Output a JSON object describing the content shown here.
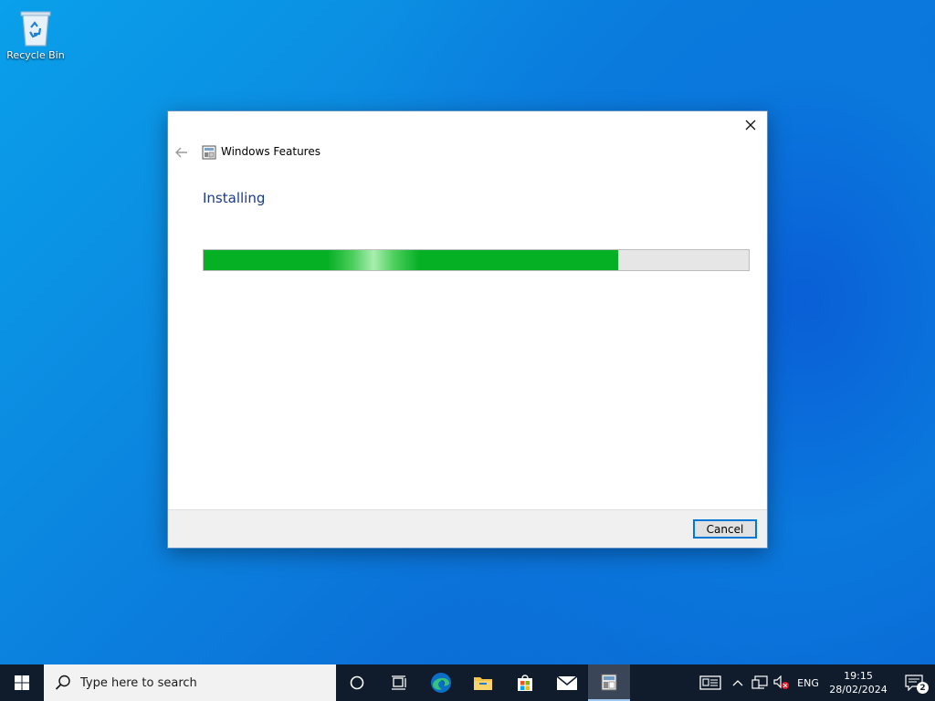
{
  "desktop": {
    "recycle_bin_label": "Recycle Bin"
  },
  "dialog": {
    "title": "Windows Features",
    "heading": "Installing",
    "progress_fraction": 0.76,
    "cancel_label": "Cancel",
    "colors": {
      "accent": "#0078d7",
      "progress": "#06b025",
      "heading": "#1a3b8a"
    }
  },
  "taskbar": {
    "search_placeholder": "Type here to search",
    "apps": [
      "cortana-icon",
      "task-view-icon",
      "edge-icon",
      "file-explorer-icon",
      "store-icon",
      "mail-icon",
      "windows-features-icon"
    ],
    "tray": {
      "language": "ENG",
      "time": "19:15",
      "date": "28/02/2024",
      "notification_count": "2"
    }
  }
}
